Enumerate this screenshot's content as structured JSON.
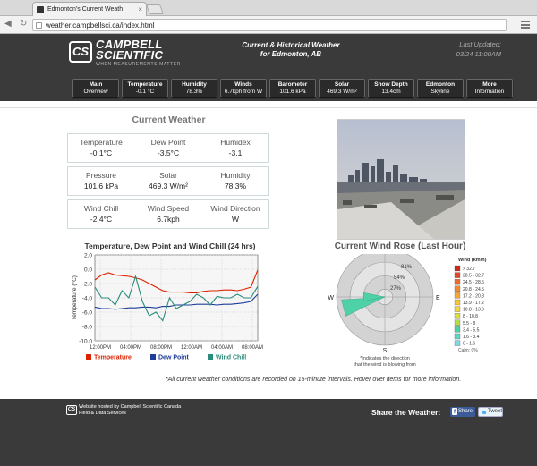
{
  "browser": {
    "tab_title": "Edmonton's Current Weath",
    "url": "weather.campbellsci.ca/index.html"
  },
  "header": {
    "logo_line1": "CAMPBELL",
    "logo_line2": "SCIENTIFIC",
    "logo_mark": "CS",
    "logo_tagline": "WHEN MEASUREMENTS MATTER",
    "title_line1": "Current & Historical Weather",
    "title_line2": "for Edmonton, AB",
    "updated_label": "Last Updated:",
    "updated_value": "03/24 11:00AM"
  },
  "nav": [
    {
      "title": "Main",
      "value": "Overview"
    },
    {
      "title": "Temperature",
      "value": "-0.1 °C"
    },
    {
      "title": "Humidity",
      "value": "78.3%"
    },
    {
      "title": "Winds",
      "value": "6.7kph from W"
    },
    {
      "title": "Barometer",
      "value": "101.6 kPa"
    },
    {
      "title": "Solar",
      "value": "469.3 W/m²"
    },
    {
      "title": "Snow Depth",
      "value": "13.4cm"
    },
    {
      "title": "Edmonton",
      "value": "Skyline"
    },
    {
      "title": "More",
      "value": "Information"
    }
  ],
  "current": {
    "title": "Current Weather",
    "rows": [
      [
        {
          "label": "Temperature",
          "value": "-0.1°C"
        },
        {
          "label": "Dew Point",
          "value": "-3.5°C"
        },
        {
          "label": "Humidex",
          "value": "-3.1"
        }
      ],
      [
        {
          "label": "Pressure",
          "value": "101.6 kPa"
        },
        {
          "label": "Solar",
          "value": "469.3 W/m²"
        },
        {
          "label": "Humidity",
          "value": "78.3%"
        }
      ],
      [
        {
          "label": "Wind Chill",
          "value": "-2.4°C"
        },
        {
          "label": "Wind Speed",
          "value": "6.7kph"
        },
        {
          "label": "Wind Direction",
          "value": "W"
        }
      ]
    ]
  },
  "chart_data": [
    {
      "type": "line",
      "title": "Temperature, Dew Point and Wind Chill (24 hrs)",
      "xlabel": "",
      "ylabel": "Temperature (°C)",
      "ylim": [
        -10,
        2
      ],
      "y_ticks": [
        "2.0",
        "0.0",
        "-2.0",
        "-4.0",
        "-6.0",
        "-8.0",
        "-10.0"
      ],
      "x_ticks": [
        "12:00PM",
        "04:00PM",
        "08:00PM",
        "12:00AM",
        "04:00AM",
        "08:00AM"
      ],
      "grid": true,
      "legend_position": "bottom",
      "x": [
        0,
        1,
        2,
        3,
        4,
        5,
        6,
        7,
        8,
        9,
        10,
        11,
        12,
        13,
        14,
        15,
        16,
        17,
        18,
        19,
        20,
        21,
        22,
        23,
        24
      ],
      "series": [
        {
          "name": "Temperature",
          "color": "#dd2200",
          "values": [
            -1.5,
            -0.8,
            -0.5,
            -0.8,
            -0.9,
            -1.0,
            -1.2,
            -1.5,
            -2.0,
            -2.5,
            -3.0,
            -3.2,
            -3.2,
            -3.2,
            -3.3,
            -3.3,
            -3.1,
            -3.0,
            -3.0,
            -2.9,
            -2.9,
            -3.0,
            -2.8,
            -2.5,
            -0.1
          ]
        },
        {
          "name": "Dew Point",
          "color": "#1f3d99",
          "values": [
            -5.3,
            -5.5,
            -5.5,
            -5.6,
            -5.5,
            -5.4,
            -5.4,
            -5.3,
            -5.3,
            -5.4,
            -5.2,
            -5.2,
            -5.0,
            -5.0,
            -5.0,
            -4.9,
            -4.9,
            -4.9,
            -5.0,
            -4.9,
            -4.9,
            -4.8,
            -4.7,
            -4.5,
            -3.5
          ]
        },
        {
          "name": "Wind Chill",
          "color": "#2a8c7a",
          "values": [
            -2.5,
            -4.0,
            -4.0,
            -5.0,
            -3.0,
            -4.0,
            -1.0,
            -4.5,
            -6.5,
            -6.0,
            -7.2,
            -4.0,
            -5.5,
            -5.0,
            -4.5,
            -3.5,
            -4.0,
            -5.0,
            -3.8,
            -4.0,
            -4.0,
            -3.5,
            -4.0,
            -4.0,
            -2.4
          ]
        }
      ]
    },
    {
      "type": "wind-rose",
      "title": "Current Wind Rose (Last Hour)",
      "directions": [
        "N",
        "E",
        "S",
        "W"
      ],
      "rings": [
        "81%",
        "54%",
        "27%"
      ],
      "calm": "Calm: 0%",
      "note_line1": "*Indicates the direction",
      "note_line2": "that the wind is blowing from",
      "petals": [
        {
          "direction_deg": 255,
          "percent": 100,
          "speed_bin": "3.4 - 5.5"
        },
        {
          "direction_deg": 270,
          "percent": 50,
          "speed_bin": "3.4 - 5.5"
        }
      ],
      "legend_title": "Wind (km/h)",
      "legend": [
        {
          "label": "> 32.7",
          "color": "#cc2a1a"
        },
        {
          "label": "28.5 - 32.7",
          "color": "#e2462a"
        },
        {
          "label": "24.5 - 28.5",
          "color": "#f06b2c"
        },
        {
          "label": "20.8 - 24.5",
          "color": "#f38a30"
        },
        {
          "label": "17.2 - 20.8",
          "color": "#f6a835"
        },
        {
          "label": "13.9 - 17.2",
          "color": "#f9c43b"
        },
        {
          "label": "10.8 - 13.9",
          "color": "#f2d63d"
        },
        {
          "label": "8 - 10.8",
          "color": "#d9e03c"
        },
        {
          "label": "5.5 - 8",
          "color": "#b5dc4a"
        },
        {
          "label": "3.4 - 5.5",
          "color": "#4fd1a8"
        },
        {
          "label": "1.6 - 3.4",
          "color": "#5fd6c8"
        },
        {
          "label": "0 - 1.6",
          "color": "#7fd8e8"
        }
      ]
    }
  ],
  "footnote": "*All current weather conditions are recorded on 15-minute intervals. Hover over items for more information.",
  "footer": {
    "line1": "Website hosted by Campbell Scientific Canada",
    "line2": "Field & Data Services",
    "share_label": "Share the Weather:",
    "fb": "Share",
    "tw": "Tweet"
  }
}
